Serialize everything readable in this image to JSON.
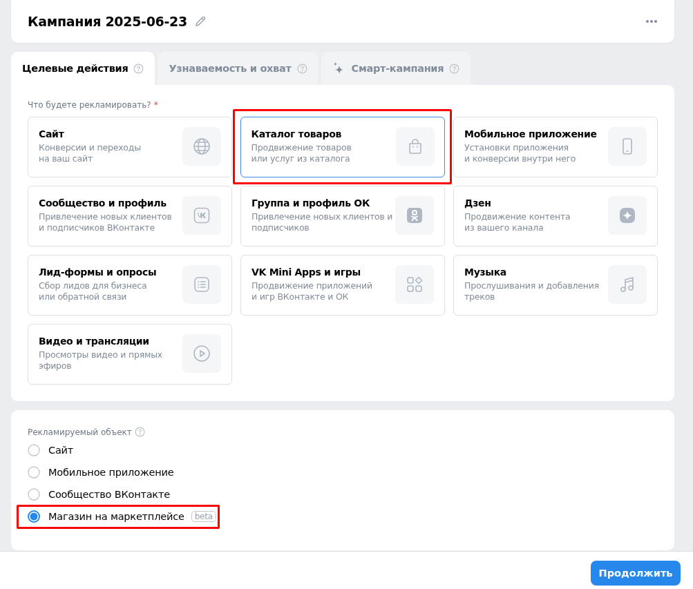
{
  "header": {
    "title": "Кампания 2025-06-23"
  },
  "tabs": [
    {
      "label": "Целевые действия",
      "selected": true,
      "kind": "plain"
    },
    {
      "label": "Узнаваемость и охват",
      "selected": false,
      "kind": "plain"
    },
    {
      "label": "Смарт-кампания",
      "selected": false,
      "kind": "smart"
    }
  ],
  "objective": {
    "label": "Что будете рекламировать?",
    "required_mark": "*",
    "cards": [
      {
        "title": "Сайт",
        "description": "Конверсии и переходы\nна ваш сайт",
        "kind": "globe",
        "selected": false,
        "highlighted": false
      },
      {
        "title": "Каталог товаров",
        "description": "Продвижение товаров\nили услуг из каталога",
        "kind": "bag",
        "selected": true,
        "highlighted": true
      },
      {
        "title": "Мобильное приложение",
        "description": "Установки приложения\nи конверсии внутри него",
        "kind": "phone",
        "selected": false,
        "highlighted": false
      },
      {
        "title": "Сообщество и профиль",
        "description": "Привлечение новых клиентов\nи подписчиков ВКонтакте",
        "kind": "vk",
        "selected": false,
        "highlighted": false
      },
      {
        "title": "Группа и профиль ОК",
        "description": "Привлечение новых клиентов и\nподписчиков",
        "kind": "ok",
        "selected": false,
        "highlighted": false
      },
      {
        "title": "Дзен",
        "description": "Продвижение контента\nиз вашего канала",
        "kind": "dzen",
        "selected": false,
        "highlighted": false
      },
      {
        "title": "Лид-формы и опросы",
        "description": "Сбор лидов для бизнеса\nили обратной связи",
        "kind": "list",
        "selected": false,
        "highlighted": false
      },
      {
        "title": "VK Mini Apps и игры",
        "description": "Продвижение приложений\nи игр ВКонтакте и ОК",
        "kind": "apps",
        "selected": false,
        "highlighted": false
      },
      {
        "title": "Музыка",
        "description": "Прослушивания и добавления\nтреков",
        "kind": "music",
        "selected": false,
        "highlighted": false
      },
      {
        "title": "Видео и трансляции",
        "description": "Просмотры видео и прямых\nэфиров",
        "kind": "video",
        "selected": false,
        "highlighted": false
      }
    ]
  },
  "promoted_object": {
    "label": "Рекламируемый объект",
    "options": [
      {
        "label": "Сайт",
        "selected": false,
        "highlighted": false
      },
      {
        "label": "Мобильное приложение",
        "selected": false,
        "highlighted": false
      },
      {
        "label": "Сообщество ВКонтакте",
        "selected": false,
        "highlighted": false
      },
      {
        "label": "Магазин на маркетплейсе",
        "badge": "beta",
        "selected": true,
        "highlighted": true
      }
    ]
  },
  "footer": {
    "button": "Продолжить"
  }
}
